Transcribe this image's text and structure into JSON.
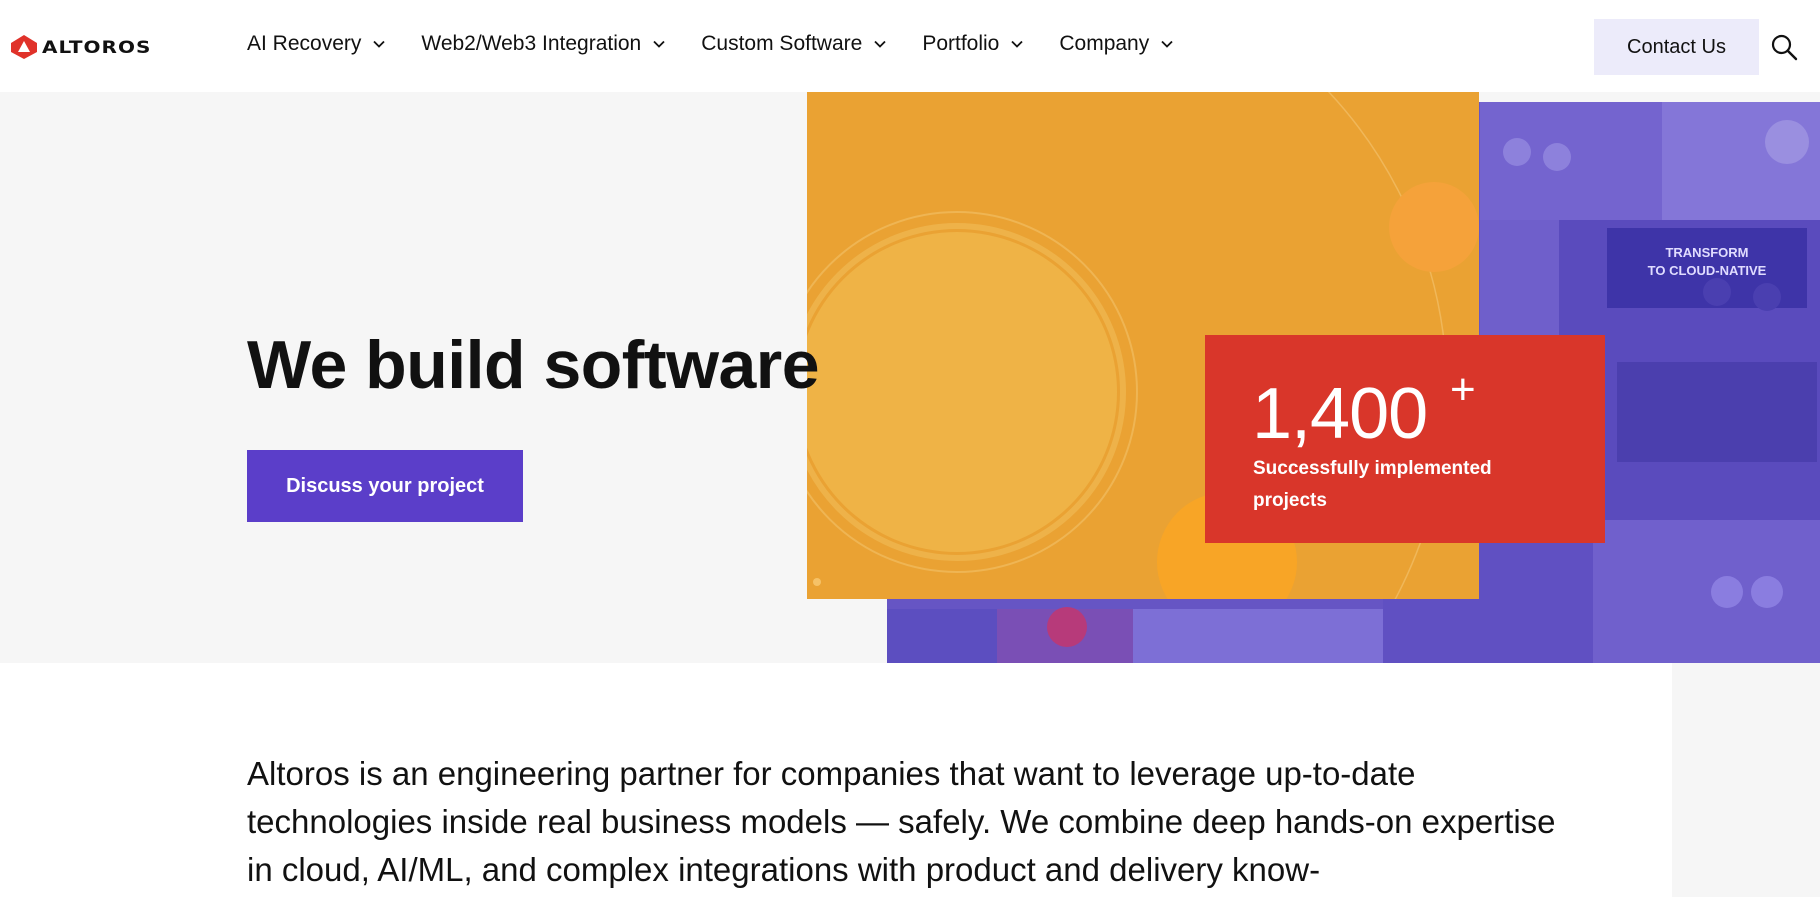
{
  "header": {
    "logo_text": "ALTOROS",
    "nav": [
      {
        "label": "AI Recovery"
      },
      {
        "label": "Web2/Web3 Integration"
      },
      {
        "label": "Custom Software"
      },
      {
        "label": "Portfolio"
      },
      {
        "label": "Company"
      }
    ],
    "contact_label": "Contact Us"
  },
  "hero": {
    "title": "We build software",
    "cta_label": "Discuss your project",
    "stat": {
      "value": "1,400",
      "suffix": "+",
      "label": "Successfully implemented projects"
    },
    "poster_text": "TRANSFORM TO CLOUD-NATIVE"
  },
  "intro": {
    "text": "Altoros is an engineering partner for companies that want to leverage up-to-date technologies inside real business models — safely. We combine deep hands-on expertise in cloud, AI/ML, and complex integrations with product and delivery know-"
  },
  "colors": {
    "accent": "#5b3ec9",
    "brand_red": "#d9362a",
    "orange": "#eaa233",
    "contact_bg": "#ecebfa"
  },
  "icons": [
    "altoros-logo-icon",
    "chevron-down-icon",
    "search-icon"
  ]
}
